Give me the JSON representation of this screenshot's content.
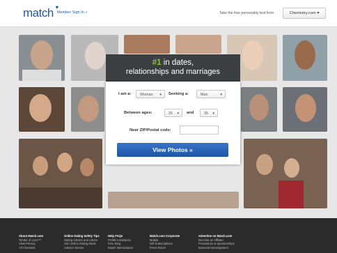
{
  "header": {
    "logo": "match",
    "member_link": "Member Sign In »",
    "promo": "Take the free personality test from",
    "chemistry_button": "Chemistry.com ▾"
  },
  "hero": {
    "headline_number": "#1",
    "headline_rest": " in dates,",
    "subheadline": "relationships and marriages"
  },
  "form": {
    "i_am_label": "I am a:",
    "i_am_value": "Woman",
    "seeking_label": "Seeking a:",
    "seeking_value": "Man",
    "ages_label": "Between ages:",
    "age_min": "25",
    "and_label": "and",
    "age_max": "35",
    "zip_label": "Near ZIP/Postal code:",
    "zip_value": "",
    "submit_label": "View Photos »"
  },
  "footer": {
    "columns": [
      {
        "heading": "About Match.com",
        "items": [
          "Tender of Love™",
          "View Privacy",
          "All Channels"
        ]
      },
      {
        "heading": "Online Dating Safety Tips",
        "items": [
          "Dating Articles and Advice",
          "Join Online Dating Mode",
          "Advisor Stories"
        ]
      },
      {
        "heading": "Help FAQs",
        "items": [
          "Profile Assistance",
          "Free Blog",
          "Match International"
        ]
      },
      {
        "heading": "Match.com Corporate",
        "items": [
          "Mobile",
          "Gift Subscriptions",
          "Press Room"
        ]
      },
      {
        "heading": "Advertise on Match.com",
        "items": [
          "Become an Affiliate",
          "Promotions & Sponsorships",
          "Business Development"
        ]
      }
    ]
  },
  "colors": {
    "brand_blue": "#1f5aa6",
    "accent_green": "#8dc63f",
    "card_dark": "#3c3f42",
    "footer_bg": "#2b2b2b"
  }
}
